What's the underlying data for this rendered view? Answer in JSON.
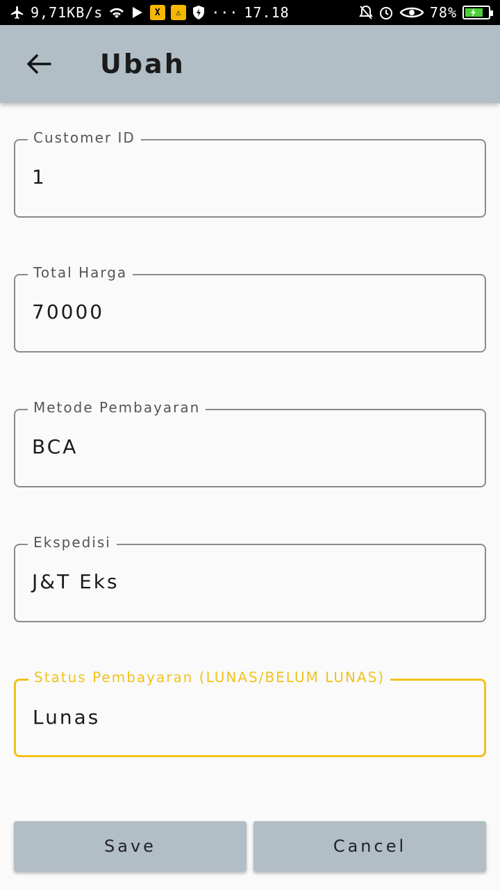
{
  "status_bar": {
    "net_speed": "9,71KB/s",
    "dots": "···",
    "time": "17.18",
    "battery": "78%",
    "badge_x": "X",
    "badge_warn": "⚠"
  },
  "app_bar": {
    "title": "Ubah"
  },
  "form": {
    "fields": [
      {
        "label": "Customer ID",
        "value": "1"
      },
      {
        "label": "Total Harga",
        "value": "70000"
      },
      {
        "label": "Metode Pembayaran",
        "value": "BCA"
      },
      {
        "label": "Ekspedisi",
        "value": "J&T Eks"
      },
      {
        "label": "Status Pembayaran (LUNAS/BELUM LUNAS)",
        "value": "Lunas"
      }
    ]
  },
  "actions": {
    "save_label": "Save",
    "cancel_label": "Cancel"
  },
  "colors": {
    "app_bar": "#b1bec6",
    "focus_accent": "#f2c21b",
    "background": "#fafafa"
  }
}
